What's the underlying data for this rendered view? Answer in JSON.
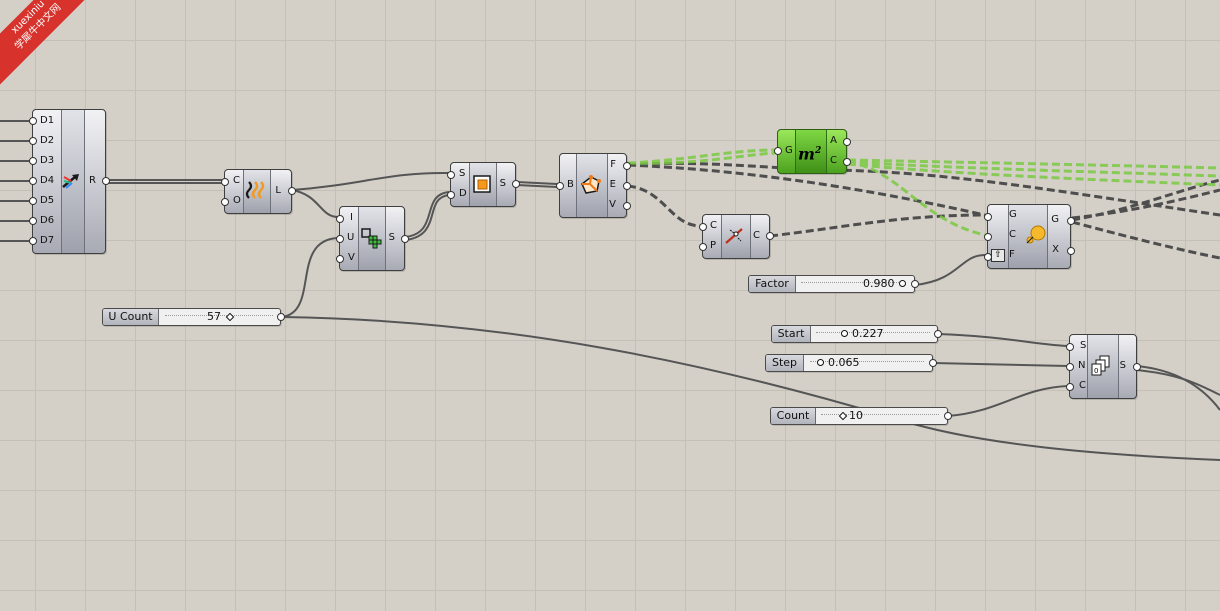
{
  "watermark": {
    "line1": "xuexiniu",
    "line2": "学犀牛中文网"
  },
  "merge": {
    "inputs": [
      "D1",
      "D2",
      "D3",
      "D4",
      "D5",
      "D6",
      "D7"
    ],
    "output": "R",
    "icon": "merge-icon"
  },
  "offset": {
    "inputs": [
      "C",
      "O"
    ],
    "output": "L",
    "icon": "offset-curve-icon"
  },
  "divide": {
    "inputs": [
      "I",
      "U",
      "V"
    ],
    "output": "S",
    "icon": "divide-surface-icon"
  },
  "boundary": {
    "inputs": [
      "S",
      "D"
    ],
    "output": "S",
    "icon": "boundary-surface-icon"
  },
  "brep": {
    "inputs": [
      "B"
    ],
    "outputs": [
      "F",
      "E",
      "V"
    ],
    "icon": "deconstruct-brep-icon"
  },
  "area": {
    "inputs": [
      "G"
    ],
    "outputs": [
      "A",
      "C"
    ],
    "icon": "area-icon",
    "accent": "#5fbf2a"
  },
  "closest": {
    "inputs": [
      "C",
      "P"
    ],
    "output": "C",
    "icon": "closest-point-icon"
  },
  "scale": {
    "inputs": [
      "G",
      "C",
      "F"
    ],
    "outputs": [
      "G",
      "X"
    ],
    "icon": "scale-icon"
  },
  "series": {
    "inputs": [
      "S",
      "N",
      "C"
    ],
    "output": "S",
    "icon": "series-icon"
  },
  "sliders": {
    "ucount": {
      "name": "U Count",
      "value": "57"
    },
    "factor": {
      "name": "Factor",
      "value": "0.980"
    },
    "start": {
      "name": "Start",
      "value": "0.227"
    },
    "step": {
      "name": "Step",
      "value": "0.065"
    },
    "count": {
      "name": "Count",
      "value": "10"
    }
  },
  "colors": {
    "canvas": "#d4d0c8",
    "wire": "#555555",
    "wire_selected": "#7ac943",
    "component": "#a8aab4"
  }
}
